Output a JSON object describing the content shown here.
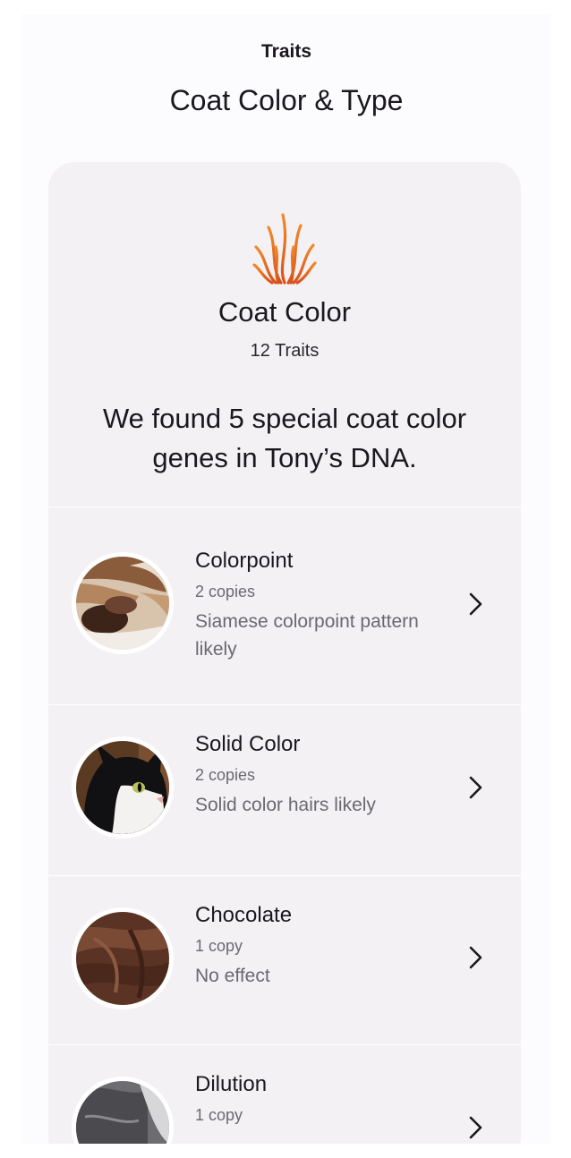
{
  "header": {
    "nav_title": "Traits",
    "page_title": "Coat Color & Type"
  },
  "section": {
    "icon": "flame-icon",
    "title": "Coat Color",
    "count": "12 Traits",
    "summary": "We found 5 special coat color genes in Tony’s DNA."
  },
  "traits": [
    {
      "name": "Colorpoint",
      "copies": "2 copies",
      "description": "Siamese colorpoint pattern likely",
      "image": "siamese-cat-paws-photo"
    },
    {
      "name": "Solid Color",
      "copies": "2 copies",
      "description": "Solid color hairs likely",
      "image": "black-white-cat-photo"
    },
    {
      "name": "Chocolate",
      "copies": "1 copy",
      "description": "No effect",
      "image": "brown-fur-photo"
    },
    {
      "name": "Dilution",
      "copies": "1 copy",
      "description": "",
      "image": "gray-fur-photo"
    }
  ],
  "colors": {
    "accent_flame": "#e2681f",
    "card_background": "#f3f1f4"
  }
}
